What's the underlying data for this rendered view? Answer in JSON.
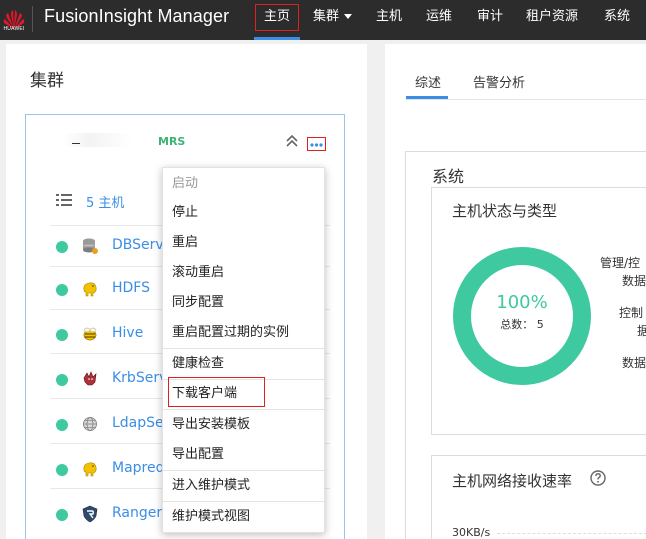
{
  "header": {
    "brand_text": "HUAWEI",
    "app_title": "FusionInsight Manager",
    "nav": [
      {
        "label": "主页",
        "active": true
      },
      {
        "label": "集群",
        "has_caret": true
      },
      {
        "label": "主机"
      },
      {
        "label": "运维"
      },
      {
        "label": "审计"
      },
      {
        "label": "租户资源"
      },
      {
        "label": "系统"
      }
    ]
  },
  "left": {
    "title": "集群",
    "cluster": {
      "tag": "MRS",
      "hosts_label": "5 主机",
      "services": [
        {
          "name": "DBService",
          "icon": "database-icon"
        },
        {
          "name": "HDFS",
          "icon": "hadoop-elephant-icon"
        },
        {
          "name": "Hive",
          "icon": "hive-bee-icon"
        },
        {
          "name": "KrbServer",
          "icon": "kerberos-dog-icon"
        },
        {
          "name": "LdapServer",
          "icon": "ldap-globe-icon"
        },
        {
          "name": "Mapreduce",
          "icon": "hadoop-elephant-icon"
        },
        {
          "name": "Ranger",
          "icon": "ranger-shield-icon"
        }
      ]
    }
  },
  "menu": {
    "items": [
      {
        "label": "启动",
        "disabled": true
      },
      {
        "label": "停止"
      },
      {
        "label": "重启"
      },
      {
        "label": "滚动重启"
      },
      {
        "label": "同步配置"
      },
      {
        "label": "重启配置过期的实例"
      },
      {
        "label": "健康检查"
      },
      {
        "label": "下载客户端",
        "highlighted": true
      },
      {
        "label": "导出安装模板"
      },
      {
        "label": "导出配置"
      },
      {
        "label": "进入维护模式"
      },
      {
        "label": "维护模式视图"
      }
    ]
  },
  "right": {
    "tabs": [
      {
        "label": "综述",
        "active": true
      },
      {
        "label": "告警分析"
      }
    ],
    "system": {
      "title": "系统",
      "host_status": {
        "title": "主机状态与类型",
        "percent": "100%",
        "total_label": "总数： 5",
        "legend": [
          "管理/控",
          "数据",
          "控制",
          "据",
          "数据"
        ]
      },
      "network": {
        "title": "主机网络接收速率",
        "y_label": "30KB/s"
      }
    }
  },
  "colors": {
    "topbar": "#2c2c2c",
    "accent": "#3a8ee6",
    "healthy": "#3ec9a0",
    "highlight_border": "#e02020"
  }
}
